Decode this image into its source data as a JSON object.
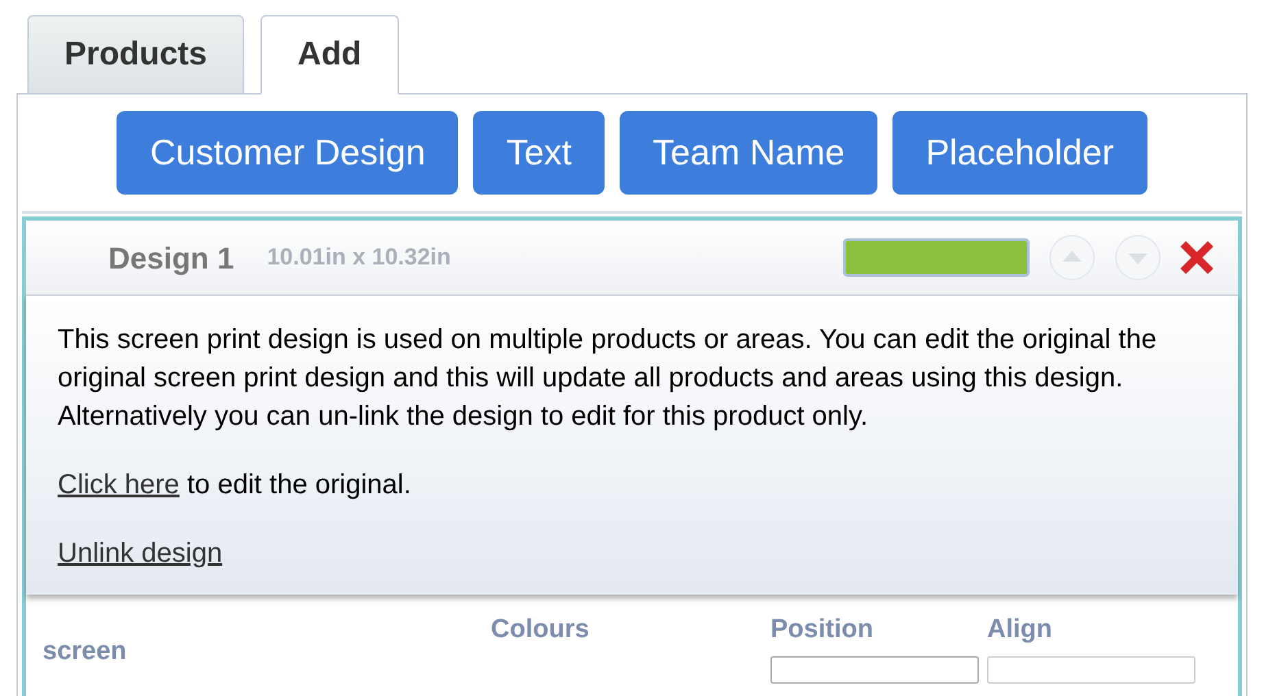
{
  "tabs": [
    {
      "label": "Products",
      "selected": false
    },
    {
      "label": "Add",
      "selected": true
    }
  ],
  "add_buttons": [
    "Customer Design",
    "Text",
    "Team Name",
    "Placeholder"
  ],
  "design": {
    "title": "Design 1",
    "size": "10.01in x 10.32in",
    "level": 1,
    "message": "This screen print design is used on multiple products or areas. You can edit the original the original screen print design and this will update all products and areas using this design. Alternatively you can un-link the design to edit for this product only.",
    "edit_link": "Click here",
    "edit_text": " to edit the original.",
    "unlink_link": "Unlink design",
    "row_label": "screen",
    "columns": [
      "Colours",
      "Position",
      "Align"
    ]
  }
}
